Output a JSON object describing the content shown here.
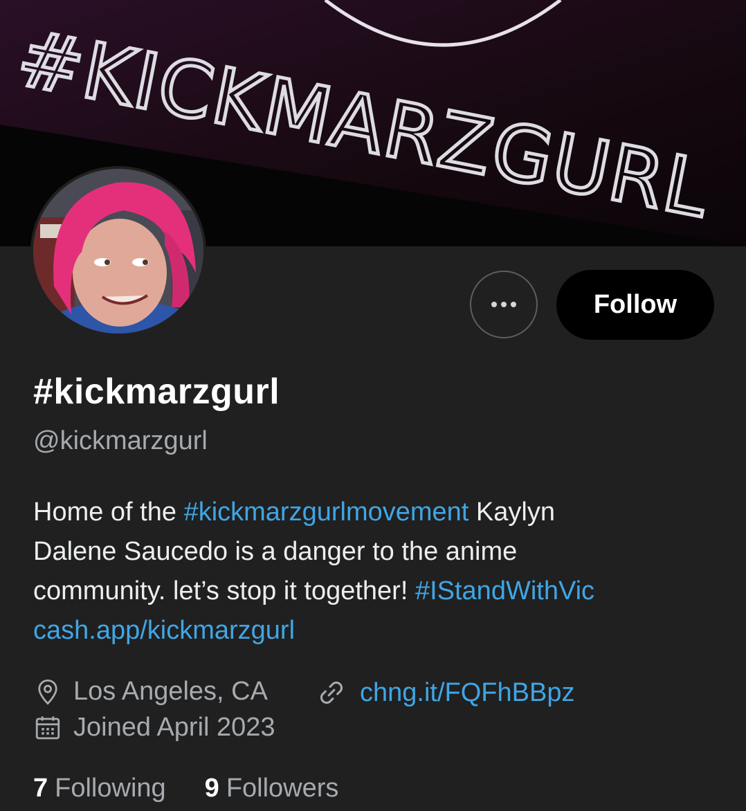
{
  "banner": {
    "text": "#KICKMARZGURL"
  },
  "profile": {
    "display_name": "#kickmarzgurl",
    "handle": "@kickmarzgurl",
    "follow_label": "Follow"
  },
  "bio": {
    "line1_pre": "Home of the ",
    "line1_tag": "#kickmarzgurlmovement",
    "line1_post": " Kaylyn",
    "line2": "Dalene Saucedo is a danger to the anime",
    "line3_pre": "community. let’s stop it together! ",
    "line3_tag": "#IStandWithVic",
    "line4_link": "cash.app/kickmarzgurl"
  },
  "meta": {
    "location": "Los Angeles, CA",
    "url": "chng.it/FQFhBBpz",
    "joined": "Joined April 2023"
  },
  "stats": {
    "following_count": "7",
    "following_label": "Following",
    "followers_count": "9",
    "followers_label": "Followers"
  },
  "colors": {
    "background": "#202020",
    "link": "#3fa6e6",
    "follow_button": "#000000"
  },
  "icons": {
    "more": "more-horizontal-icon",
    "location": "location-pin-icon",
    "url": "link-icon",
    "joined": "calendar-icon"
  }
}
